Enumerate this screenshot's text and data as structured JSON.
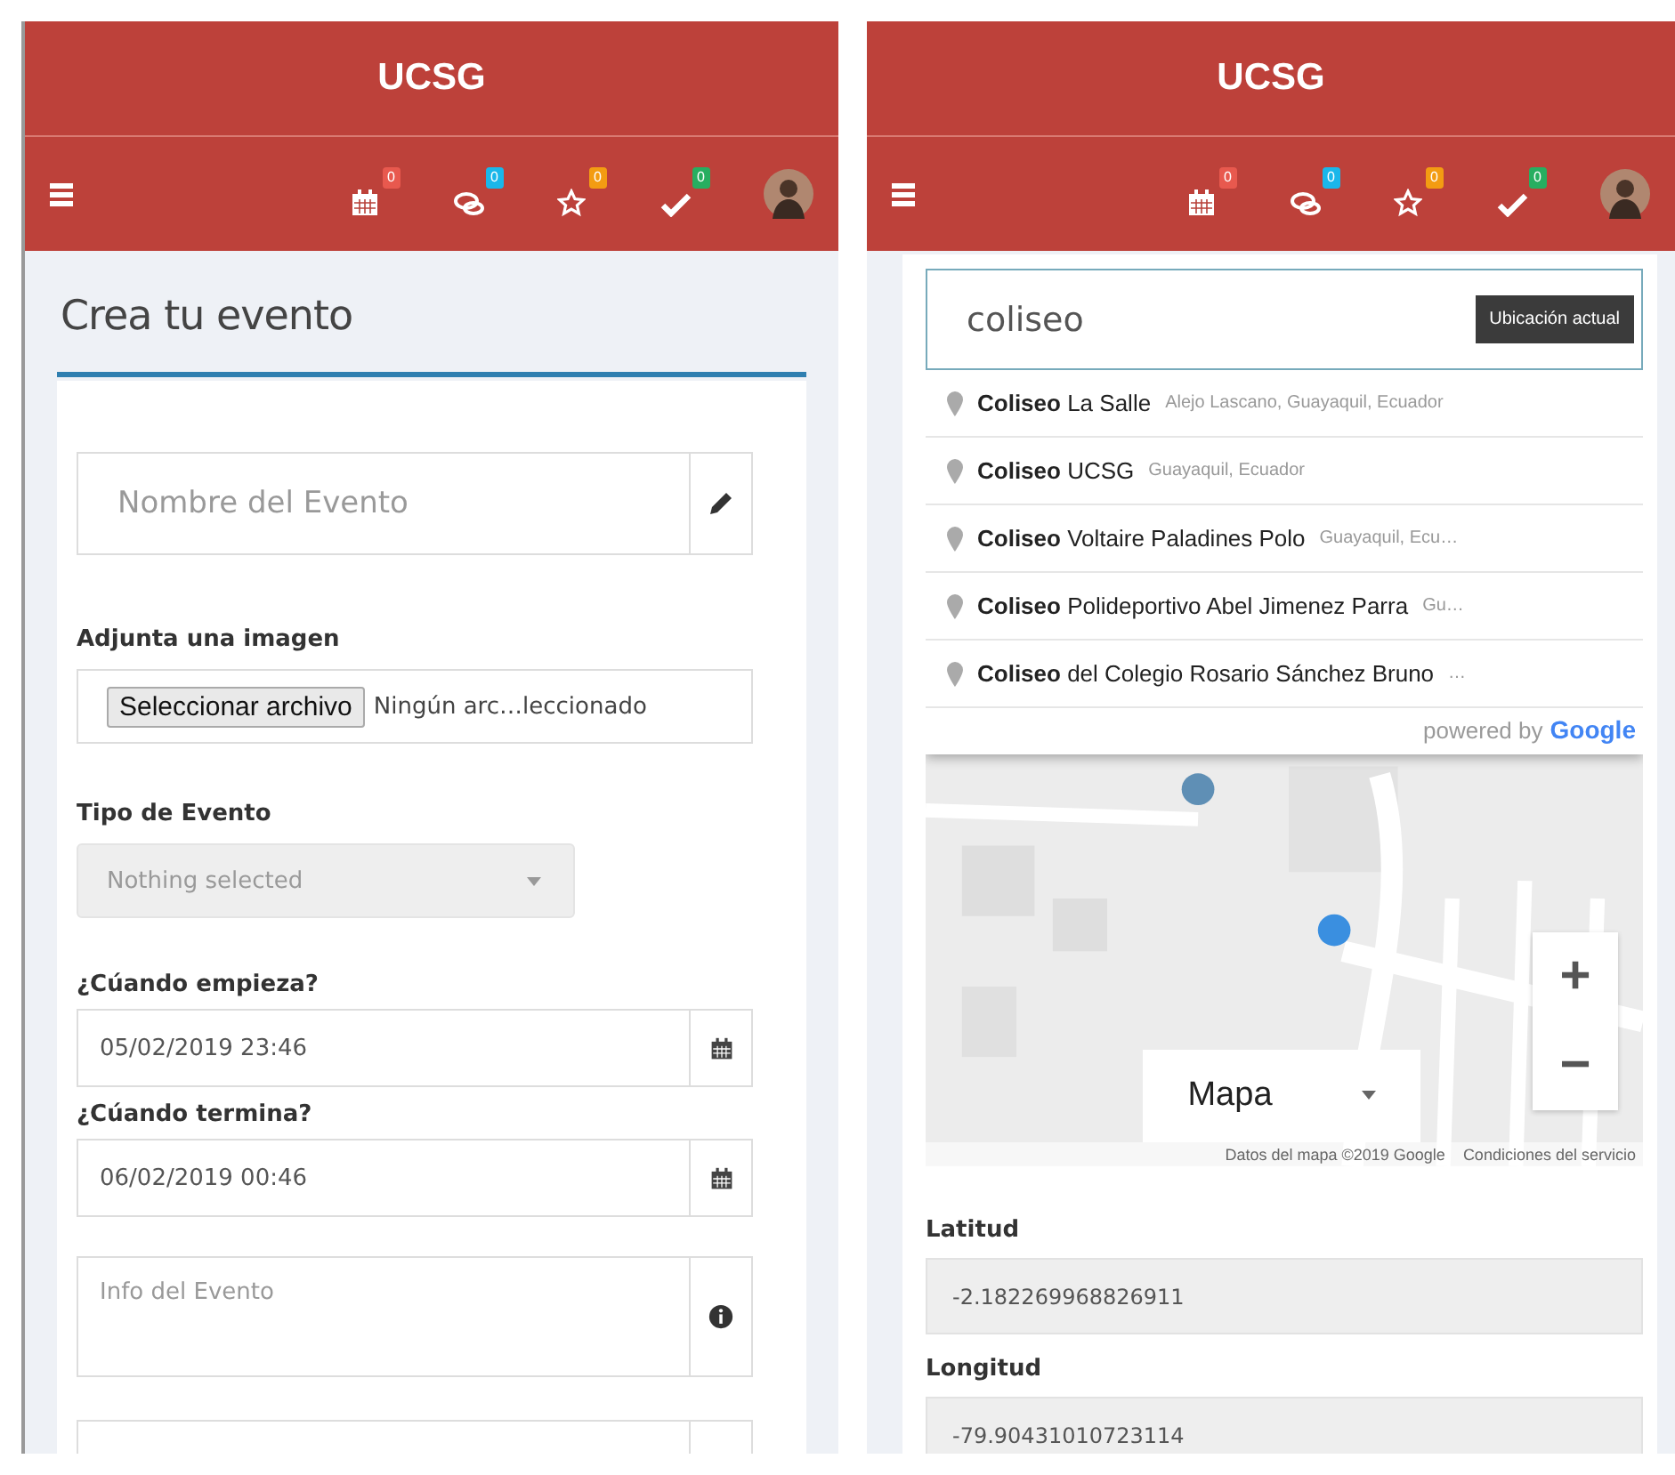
{
  "left_screen": {
    "app_bar": {
      "title": "UCSG",
      "notifications": [
        {
          "kind": "calendar",
          "count": "0",
          "color": "#e8594e"
        },
        {
          "kind": "comments",
          "count": "0",
          "color": "#1ab7ea"
        },
        {
          "kind": "star",
          "count": "0",
          "color": "#f39c12"
        },
        {
          "kind": "check",
          "count": "0",
          "color": "#27ae60"
        }
      ]
    },
    "page_title": "Crea tu evento",
    "fields": [
      {
        "kind": "text",
        "placeholder": "Nombre del Evento"
      },
      {
        "kind": "file",
        "label": "Adjunta una imagen",
        "button": "Seleccionar archivo",
        "value": "Ningún arc…leccionado"
      },
      {
        "kind": "select",
        "label": "Tipo de Evento",
        "placeholder": "Nothing selected",
        "disabled": true
      },
      {
        "kind": "date",
        "label": "¿Cúando empieza?",
        "value": "05/02/2019 23:46"
      },
      {
        "kind": "date",
        "label": "¿Cúando termina?",
        "value": "06/02/2019 00:46"
      },
      {
        "kind": "textarea",
        "placeholder": "Info del Evento"
      },
      {
        "kind": "cut"
      }
    ]
  },
  "right_screen": {
    "app_bar": {
      "title": "UCSG",
      "notifications": [
        {
          "kind": "calendar",
          "count": "0",
          "color": "#e8594e"
        },
        {
          "kind": "comments",
          "count": "0",
          "color": "#1ab7ea"
        },
        {
          "kind": "star",
          "count": "0",
          "color": "#f39c12"
        },
        {
          "kind": "check",
          "count": "0",
          "color": "#27ae60"
        }
      ]
    },
    "search": {
      "value": "coliseo",
      "button": "Ubicación actual"
    },
    "suggestions": [
      {
        "main": "**Coliseo** La Salle",
        "secondary": "Alejo Lascano, Guayaquil, Ecuador"
      },
      {
        "main": "**Coliseo** UCSG",
        "secondary": "Guayaquil, Ecuador"
      },
      {
        "main": "**Coliseo** Voltaire Paladines Polo",
        "secondary": "Guayaquil, Ecu…"
      },
      {
        "main": "**Coliseo** Polideportivo Abel Jimenez Parra",
        "secondary": "Gu…"
      },
      {
        "main": "**Coliseo** del Colegio Rosario Sánchez Bruno",
        "secondary": "…"
      }
    ],
    "powered_by": {
      "text": "powered by",
      "brand": "Google"
    },
    "map": {
      "kind": "picture",
      "map_type": "Mapa",
      "zoom_in": "+",
      "zoom_out": "−",
      "attribution": "Datos del mapa ©2019 Google",
      "terms": "Condiciones del servicio"
    },
    "coordinates": [
      {
        "label": "Latitud",
        "value": "-2.182269968826911"
      },
      {
        "label": "Longitud",
        "value": "-79.90431010723114"
      }
    ]
  }
}
